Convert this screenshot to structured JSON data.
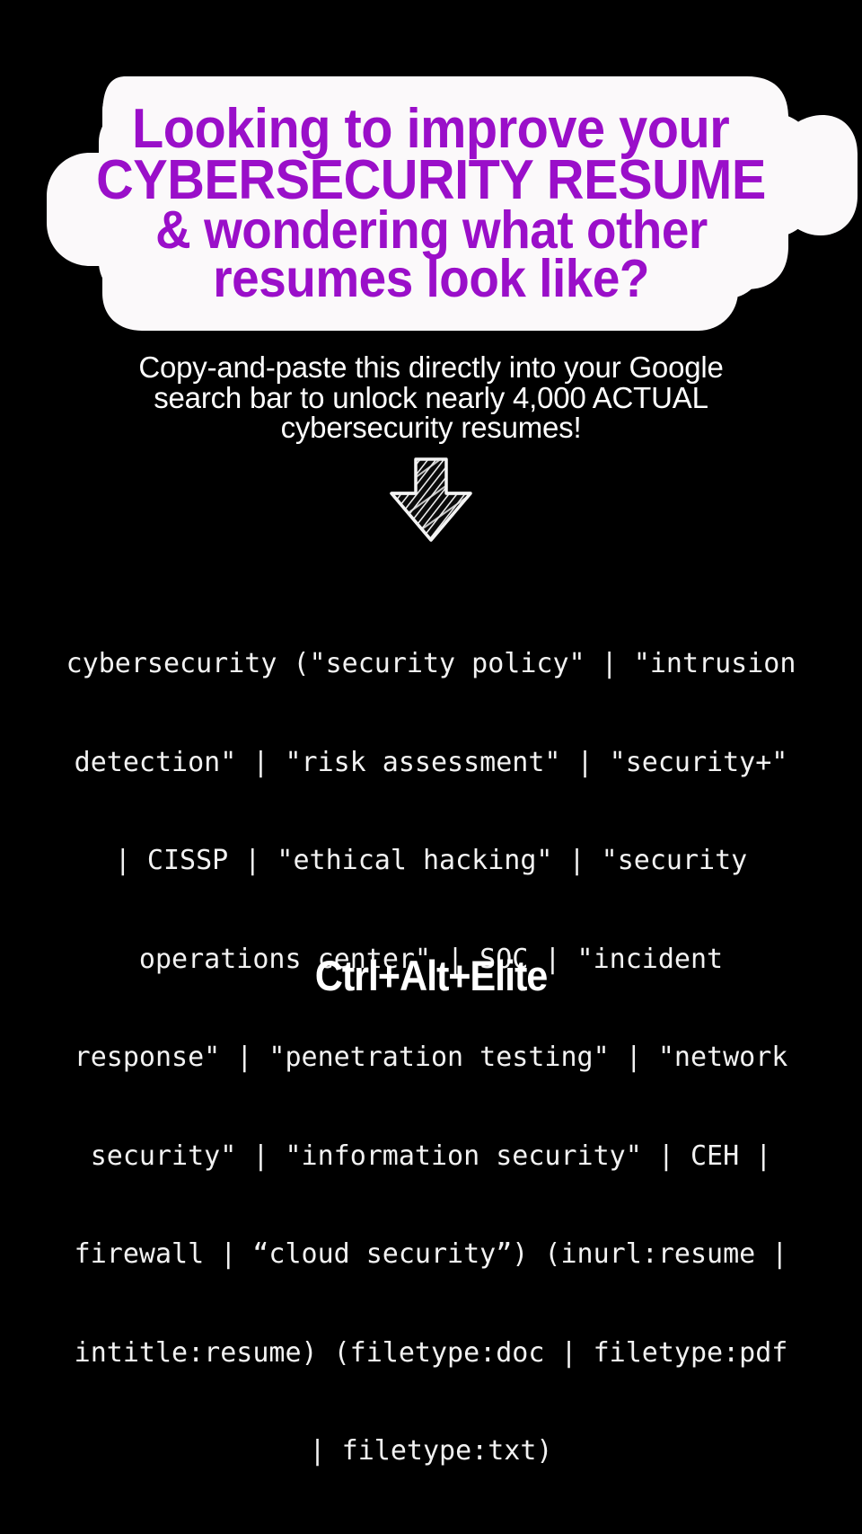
{
  "poster": {
    "background_color": "#000000",
    "accent_color": "#9A0FC9",
    "text_color": "#FFFFFF",
    "sticker_color": "#FBF9FA"
  },
  "headline": {
    "line1": "Looking to improve your",
    "line2": "CYBERSECURITY RESUME",
    "line3": "&  wondering what other",
    "line4": "resumes look like?"
  },
  "subtitle": {
    "line1": "Copy-and-paste this directly into your Google",
    "line2": "search bar to unlock nearly 4,000 ACTUAL",
    "line3": "cybersecurity resumes!"
  },
  "arrow": {
    "icon": "down-arrow-sketch-icon",
    "direction": "down"
  },
  "search_query": {
    "line1": "cybersecurity (\"security policy\" | \"intrusion",
    "line2": "detection\" | \"risk assessment\" | \"security+\"",
    "line3": "| CISSP | \"ethical hacking\" | \"security",
    "line4": "operations center\" | SOC | \"incident",
    "line5": "response\" | \"penetration testing\" | \"network",
    "line6": "security\" | \"information security\" | CEH |",
    "line7": "firewall | “cloud security”) (inurl:resume |",
    "line8": "intitle:resume) (filetype:doc | filetype:pdf",
    "line9": "| filetype:txt)"
  },
  "brand": {
    "name": "Ctrl+Alt+Elite"
  }
}
